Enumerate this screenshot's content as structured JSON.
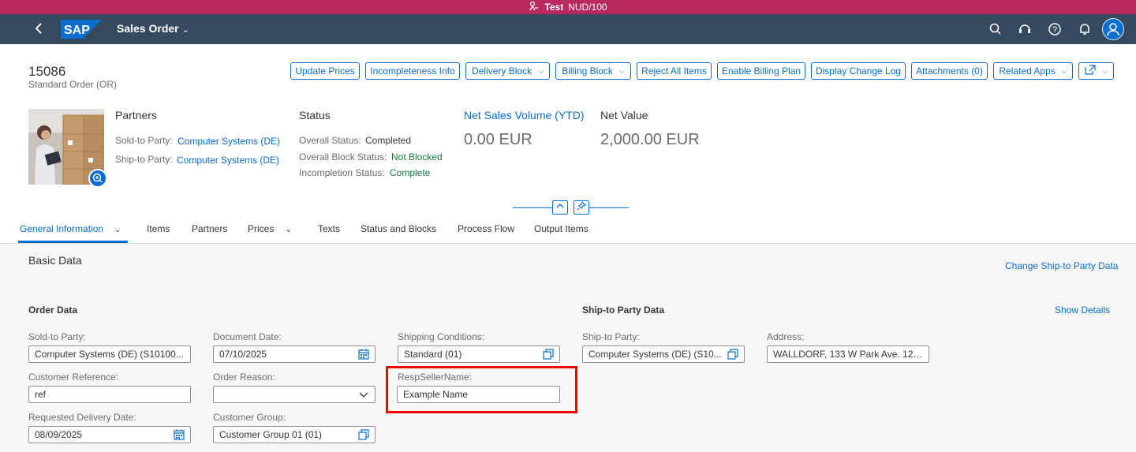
{
  "system_bar": {
    "label": "Test",
    "client": "NUD/100"
  },
  "shell": {
    "app_title": "Sales Order",
    "logo_text": "SAP"
  },
  "object": {
    "id": "15086",
    "subtitle": "Standard Order (OR)"
  },
  "actions": [
    "Update Prices",
    "Incompleteness Info",
    "Delivery Block",
    "Billing Block",
    "Reject All Items",
    "Enable Billing Plan",
    "Display Change Log",
    "Attachments (0)",
    "Related Apps"
  ],
  "partners": {
    "title": "Partners",
    "sold_to_label": "Sold-to Party:",
    "sold_to_value": "Computer Systems (DE)",
    "ship_to_label": "Ship-to Party:",
    "ship_to_value": "Computer Systems (DE)"
  },
  "status": {
    "title": "Status",
    "overall_label": "Overall Status:",
    "overall_value": "Completed",
    "block_label": "Overall Block Status:",
    "block_value": "Not Blocked",
    "incompletion_label": "Incompletion Status:",
    "incompletion_value": "Complete"
  },
  "kpis": {
    "net_sales_title": "Net Sales Volume (YTD)",
    "net_sales_value": "0.00",
    "net_sales_unit": "EUR",
    "net_value_title": "Net Value",
    "net_value_value": "2,000.00",
    "net_value_unit": "EUR"
  },
  "tabs": [
    "General Information",
    "Items",
    "Partners",
    "Prices",
    "Texts",
    "Status and Blocks",
    "Process Flow",
    "Output Items"
  ],
  "section": {
    "title": "Basic Data",
    "change_ship_link": "Change Ship-to Party Data",
    "order_data_title": "Order Data",
    "ship_data_title": "Ship-to Party Data",
    "show_details": "Show Details"
  },
  "fields": {
    "sold_to_label": "Sold-to Party:",
    "sold_to_value": "Computer Systems (DE) (S10100...",
    "doc_date_label": "Document Date:",
    "doc_date_value": "07/10/2025",
    "shipping_label": "Shipping Conditions:",
    "shipping_value": "Standard (01)",
    "ship_party_label": "Ship-to Party:",
    "ship_party_value": "Computer Systems (DE) (S10...",
    "address_label": "Address:",
    "address_value": "WALLDORF, 133 W Park Ave. 124...",
    "cust_ref_label": "Customer Reference:",
    "cust_ref_value": "ref",
    "order_reason_label": "Order Reason:",
    "order_reason_value": "",
    "resp_seller_label": "RespSellerName:",
    "resp_seller_value": "Example Name",
    "req_delivery_label": "Requested Delivery Date:",
    "req_delivery_value": "08/09/2025",
    "cust_group_label": "Customer Group:",
    "cust_group_value": "Customer Group 01 (01)"
  },
  "colors": {
    "system_bar": "#b9295f",
    "shell": "#354a5f",
    "accent": "#0a6ed1",
    "positive": "#107e3e",
    "highlight": "#ee0000"
  }
}
